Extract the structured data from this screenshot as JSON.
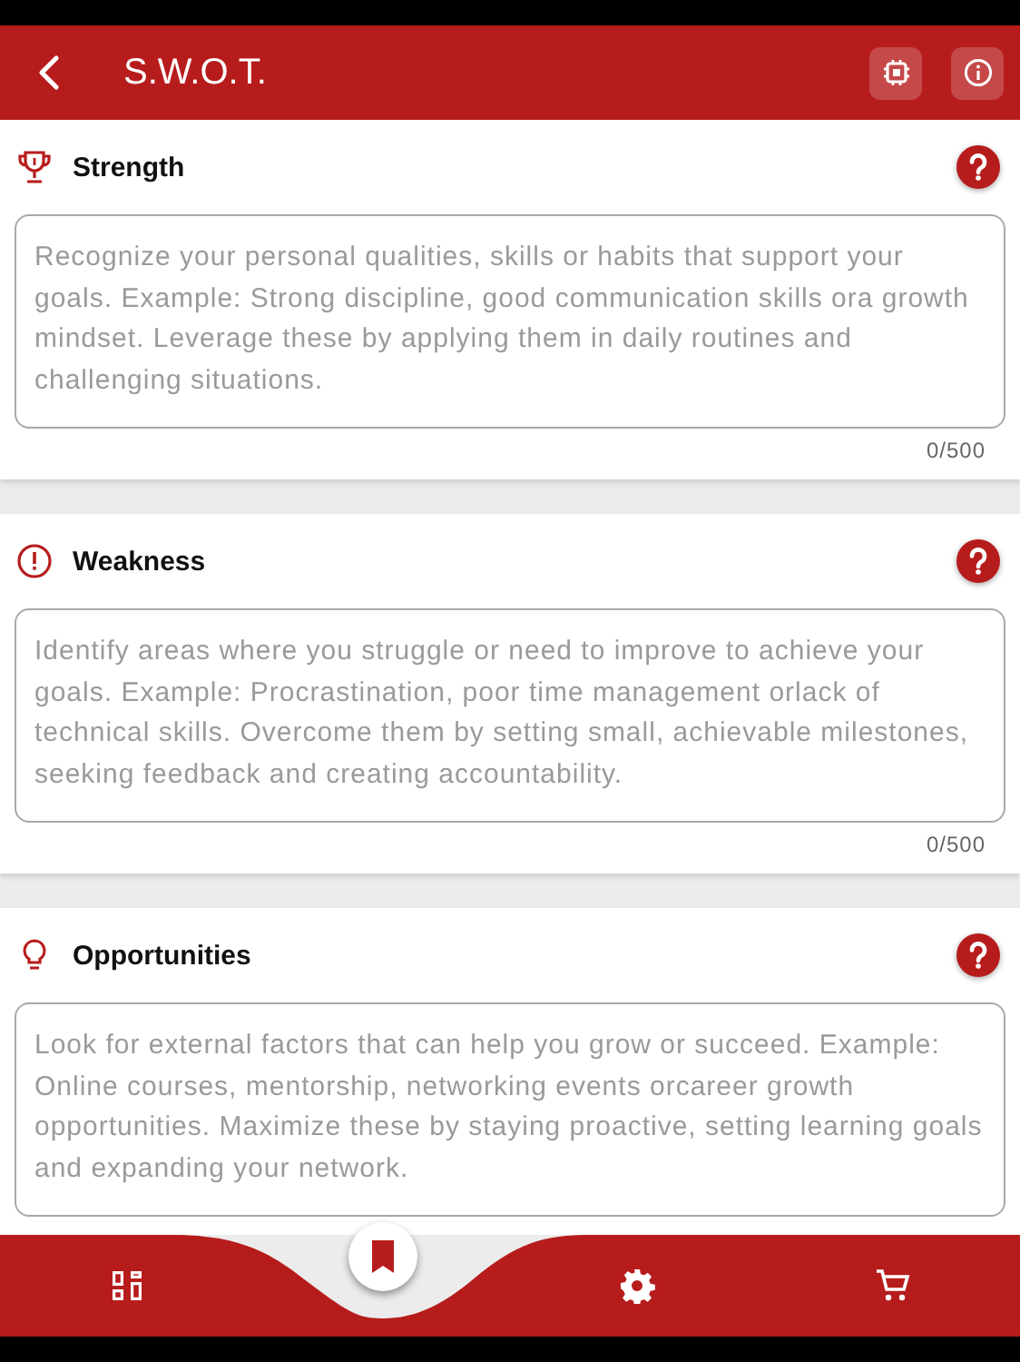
{
  "header": {
    "title": "S.W.O.T."
  },
  "sections": [
    {
      "kind": "trophy",
      "title": "Strength",
      "placeholder": "Recognize your personal qualities, skills or habits that support your goals. Example: Strong discipline, good communication skills ora growth mindset. Leverage these by applying them in daily routines and challenging situations.",
      "counter": "0/500"
    },
    {
      "kind": "alert",
      "title": "Weakness",
      "placeholder": "Identify areas where you struggle or need to improve to achieve your goals. Example: Procrastination, poor time management orlack of technical skills. Overcome them by setting small, achievable milestones, seeking feedback and creating accountability.",
      "counter": "0/500"
    },
    {
      "kind": "bulb",
      "title": "Opportunities",
      "placeholder": "Look for external factors that can help you grow or succeed. Example: Online courses, mentorship, networking events orcareer growth opportunities. Maximize these by staying proactive, setting learning goals and expanding your network."
    }
  ],
  "bottom_nav": [
    {
      "kind": "dashboard",
      "selected": false
    },
    {
      "kind": "bookmark",
      "selected": true
    },
    {
      "kind": "settings",
      "selected": false
    },
    {
      "kind": "cart",
      "selected": false
    }
  ]
}
